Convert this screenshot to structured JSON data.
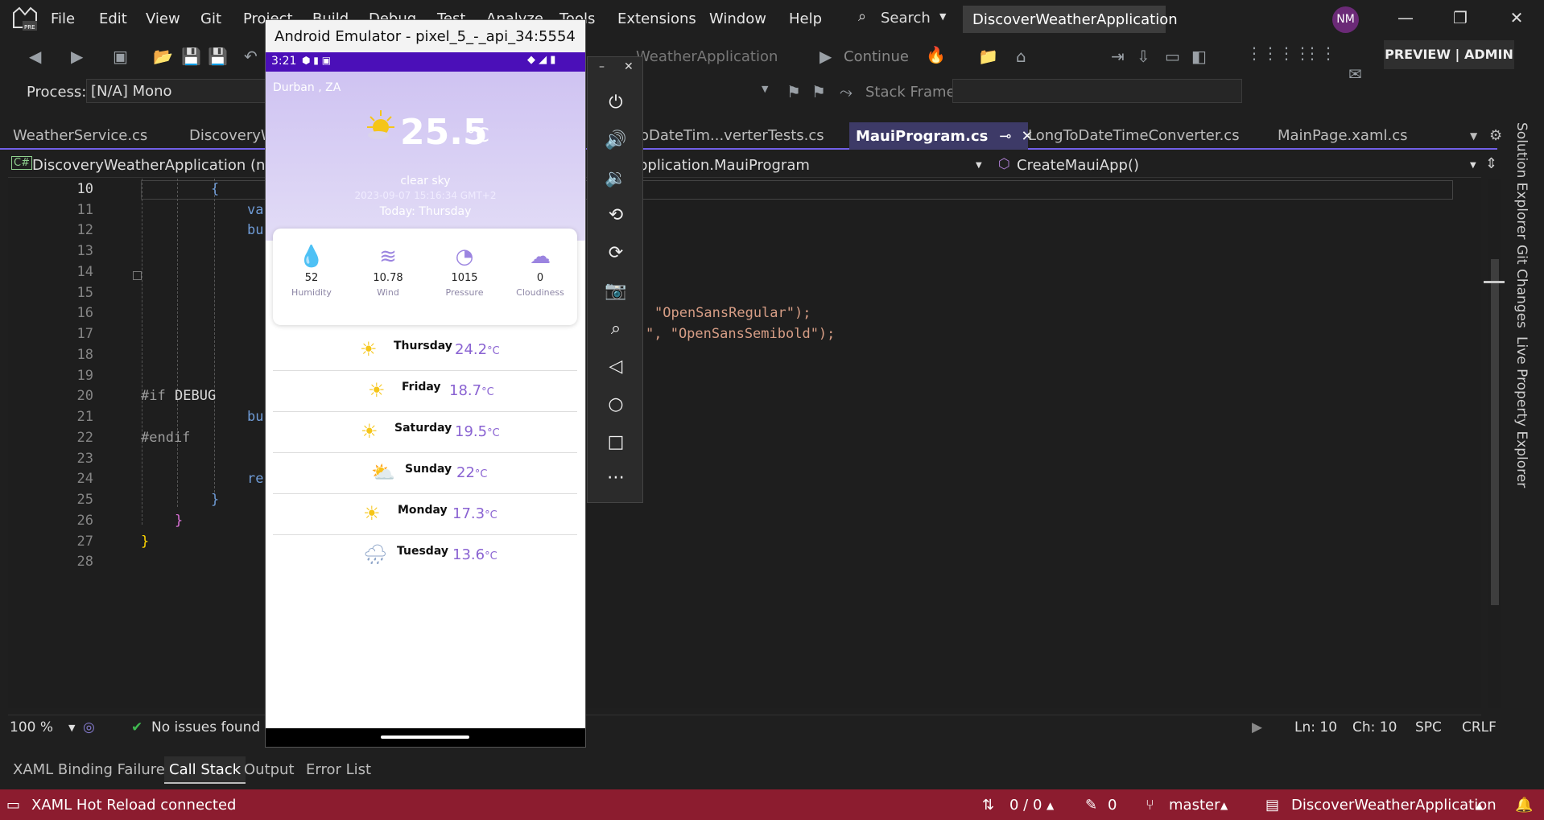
{
  "menu": [
    "File",
    "Edit",
    "View",
    "Git",
    "Project",
    "Build",
    "Debug",
    "Test",
    "Analyze",
    "Tools",
    "Extensions",
    "Window",
    "Help"
  ],
  "search_label": "Search",
  "solution_title": "DiscoverWeatherApplication",
  "avatar": "NM",
  "preview_badge": "PREVIEW | ADMIN",
  "toolbar": {
    "startup_project": "WeatherApplication",
    "continue": "Continue"
  },
  "process": {
    "label": "Process:",
    "value": "[N/A] Mono",
    "stack_frame_label": "Stack Frame:"
  },
  "tabs": [
    "WeatherService.cs",
    "DiscoveryW",
    "oDateTim...verterTests.cs",
    "MauiProgram.cs",
    "LongToDateTimeConverter.cs",
    "MainPage.xaml.cs"
  ],
  "active_tab": "MauiProgram.cs",
  "navbar": {
    "project": "DiscoveryWeatherApplication (net8.0",
    "class": "pplication.MauiProgram",
    "member": "CreateMauiApp()"
  },
  "editor": {
    "line_numbers": [
      "10",
      "11",
      "12",
      "13",
      "14",
      "15",
      "16",
      "17",
      "18",
      "19",
      "20",
      "21",
      "22",
      "23",
      "24",
      "25",
      "26",
      "27",
      "28"
    ],
    "fragments": [
      "{",
      "va",
      "bu",
      "\"OpenSansRegular\");",
      "\", \"OpenSansSemibold\");",
      "#if",
      "DEBUG",
      "bu",
      "#endif",
      "re",
      "}",
      "}",
      "}"
    ]
  },
  "status_line": {
    "zoom": "100 %",
    "issues": "No issues found",
    "ln": "Ln: 10",
    "ch": "Ch: 10",
    "spc": "SPC",
    "crlf": "CRLF"
  },
  "bottom_tabs": [
    "XAML Binding Failures",
    "Call Stack",
    "Output",
    "Error List"
  ],
  "statusbar": {
    "hot_reload": "XAML Hot Reload connected",
    "changes": "0 / 0",
    "edits": "0",
    "branch": "master",
    "solution": "DiscoverWeatherApplication"
  },
  "side_panels": [
    "Solution Explorer",
    "Git Changes",
    "Live Property Explorer"
  ],
  "emulator": {
    "title": "Android Emulator - pixel_5_-_api_34:5554",
    "time": "3:21",
    "city": "Durban , ZA",
    "temp": "25.5",
    "temp_unit": "°C",
    "desc": "clear sky",
    "datetime": "2023-09-07 15:16:34 GMT+2",
    "today": "Today: Thursday",
    "stats": [
      {
        "value": "52",
        "label": "Humidity",
        "icon": "droplet-icon"
      },
      {
        "value": "10.78",
        "label": "Wind",
        "icon": "wind-icon"
      },
      {
        "value": "1015",
        "label": "Pressure",
        "icon": "gauge-icon"
      },
      {
        "value": "0",
        "label": "Cloudiness",
        "icon": "cloud-icon"
      }
    ],
    "forecast": [
      {
        "day": "Thursday",
        "temp": "24.2",
        "unit": "°C"
      },
      {
        "day": "Friday",
        "temp": "18.7",
        "unit": "°C"
      },
      {
        "day": "Saturday",
        "temp": "19.5",
        "unit": "°C"
      },
      {
        "day": "Sunday",
        "temp": "22",
        "unit": "°C"
      },
      {
        "day": "Monday",
        "temp": "17.3",
        "unit": "°C"
      },
      {
        "day": "Tuesday",
        "temp": "13.6",
        "unit": "°C"
      }
    ]
  },
  "colors": {
    "accent": "#7160e8",
    "statusbar": "#8c1c2f",
    "emulator_status": "#4b0fb8",
    "forecast_temp": "#8a63d2"
  }
}
